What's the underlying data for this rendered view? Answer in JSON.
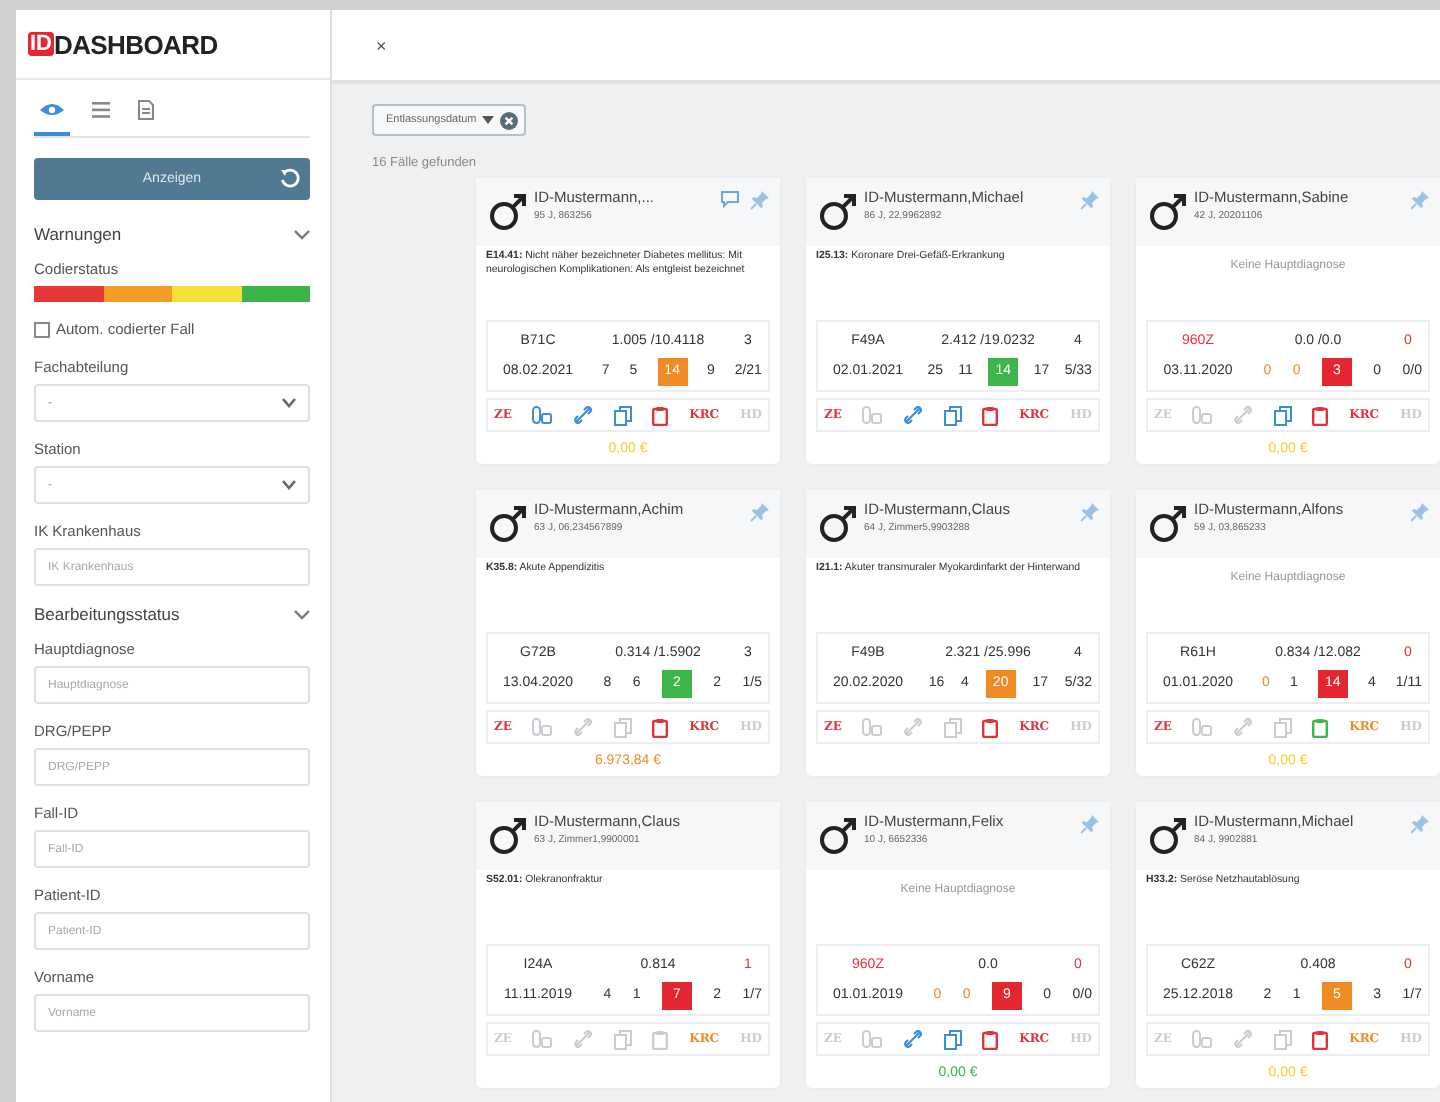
{
  "sidebar": {
    "brand": {
      "prefix": "ID",
      "name": "DASHBOARD"
    },
    "tabs": [
      {
        "kind": "eye",
        "selected": true
      },
      {
        "kind": "list",
        "selected": false
      },
      {
        "kind": "document",
        "selected": false
      }
    ],
    "button": "Anzeigen",
    "items": [
      {
        "kind": "section",
        "label": "Warnungen"
      },
      {
        "kind": "statusbar",
        "label": "Codierstatus",
        "segments": [
          {
            "color": "#e53935"
          },
          {
            "color": "#f39c26"
          },
          {
            "color": "#f7e03a"
          },
          {
            "color": "#3bb54a"
          }
        ]
      },
      {
        "kind": "checkbox",
        "label": "Autom. codierter Fall",
        "checked": false
      },
      {
        "kind": "select",
        "label": "Fachabteilung",
        "value": "-"
      },
      {
        "kind": "select",
        "label": "Station",
        "value": "-"
      },
      {
        "kind": "input",
        "label": "IK Krankenhaus",
        "placeholder": "IK Krankenhaus"
      },
      {
        "kind": "section",
        "label": "Bearbeitungsstatus"
      },
      {
        "kind": "input",
        "label": "Hauptdiagnose",
        "placeholder": "Hauptdiagnose"
      },
      {
        "kind": "input",
        "label": "DRG/PEPP",
        "placeholder": "DRG/PEPP"
      },
      {
        "kind": "input",
        "label": "Fall-ID",
        "placeholder": "Fall-ID"
      },
      {
        "kind": "input",
        "label": "Patient-ID",
        "placeholder": "Patient-ID"
      },
      {
        "kind": "input",
        "label": "Vorname",
        "placeholder": "Vorname"
      }
    ]
  },
  "toolbar": {
    "close": "×",
    "sort": "Entlassungsdatum",
    "result_count": "16 Fälle gefunden"
  },
  "cards": [
    {
      "name": "ID-Mustermann,...",
      "info": "95 J, 863256",
      "header_icons": [
        {
          "kind": "comment"
        },
        {
          "kind": "pin"
        }
      ],
      "diagnosis": "**E14.41:** Nicht näher bezeichneter Diabetes mellitus: Mit neurologischen Komplikationen: Als entgleist bezeichnet",
      "row1": [
        {
          "text": "B71C"
        },
        {
          "text": "1.005 /10.4118"
        },
        {
          "text": "3"
        }
      ],
      "row2": [
        {
          "text": "08.02.2021"
        },
        {
          "text": "7"
        },
        {
          "text": "5"
        },
        {
          "text": "14",
          "boxed": true,
          "color": "#f08a24"
        },
        {
          "text": "9"
        },
        {
          "text": "2/21"
        }
      ],
      "flags": [
        {
          "kind": "ze",
          "label": "ZE",
          "color": "#e0333a"
        },
        {
          "kind": "pills",
          "color": "#3b8ed8"
        },
        {
          "kind": "link",
          "color": "#3b8ed8"
        },
        {
          "kind": "copy",
          "color": "#3b8ed8"
        },
        {
          "kind": "clipboard",
          "color": "#e0333a"
        },
        {
          "kind": "krc",
          "label": "KRC",
          "color": "#e0333a"
        },
        {
          "kind": "hd",
          "label": "HD",
          "color": "#c9cdd1"
        }
      ],
      "amount": {
        "text": "0,00 €",
        "color": "#f2cf2c"
      }
    },
    {
      "name": "ID-Mustermann,Michael",
      "info": "86 J, 22,9962892",
      "header_icons": [
        {
          "kind": "pin"
        }
      ],
      "diagnosis": "**I25.13:** Koronare Drei-Gefäß-Erkrankung",
      "row1": [
        {
          "text": "F49A"
        },
        {
          "text": "2.412 /19.0232"
        },
        {
          "text": "4"
        }
      ],
      "row2": [
        {
          "text": "02.01.2021"
        },
        {
          "text": "25"
        },
        {
          "text": "11"
        },
        {
          "text": "14",
          "boxed": true,
          "color": "#3cb54a"
        },
        {
          "text": "17"
        },
        {
          "text": "5/33"
        }
      ],
      "flags": [
        {
          "kind": "ze",
          "label": "ZE",
          "color": "#e0333a"
        },
        {
          "kind": "pills",
          "color": "#c9cdd1"
        },
        {
          "kind": "link",
          "color": "#3b8ed8"
        },
        {
          "kind": "copy",
          "color": "#3b8ed8"
        },
        {
          "kind": "clipboard",
          "color": "#e0333a"
        },
        {
          "kind": "krc",
          "label": "KRC",
          "color": "#e0333a"
        },
        {
          "kind": "hd",
          "label": "HD",
          "color": "#c9cdd1"
        }
      ]
    },
    {
      "name": "ID-Mustermann,Sabine",
      "info": "42 J, 20201106",
      "header_icons": [
        {
          "kind": "pin"
        }
      ],
      "no_diagnosis": "Keine Hauptdiagnose",
      "row1": [
        {
          "text": "960Z",
          "color": "#e0333a"
        },
        {
          "text": "0.0 /0.0"
        },
        {
          "text": "0",
          "color": "#e0333a"
        }
      ],
      "row2": [
        {
          "text": "03.11.2020"
        },
        {
          "text": "0",
          "color": "#f08a24"
        },
        {
          "text": "0",
          "color": "#f08a24"
        },
        {
          "text": "3",
          "boxed": true,
          "color": "#e3262f"
        },
        {
          "text": "0"
        },
        {
          "text": "0/0"
        }
      ],
      "flags": [
        {
          "kind": "ze",
          "label": "ZE",
          "color": "#c9cdd1"
        },
        {
          "kind": "pills",
          "color": "#c9cdd1"
        },
        {
          "kind": "link",
          "color": "#c9cdd1"
        },
        {
          "kind": "copy",
          "color": "#3b8ed8"
        },
        {
          "kind": "clipboard",
          "color": "#e0333a"
        },
        {
          "kind": "krc",
          "label": "KRC",
          "color": "#e0333a"
        },
        {
          "kind": "hd",
          "label": "HD",
          "color": "#c9cdd1"
        }
      ],
      "amount": {
        "text": "0,00 €",
        "color": "#f2cf2c"
      }
    },
    {
      "name": "ID-Mustermann,Achim",
      "info": "63 J, 06,234567899",
      "header_icons": [
        {
          "kind": "pin"
        }
      ],
      "diagnosis": "**K35.8:** Akute Appendizitis",
      "row1": [
        {
          "text": "G72B"
        },
        {
          "text": "0.314 /1.5902"
        },
        {
          "text": "3"
        }
      ],
      "row2": [
        {
          "text": "13.04.2020"
        },
        {
          "text": "8"
        },
        {
          "text": "6"
        },
        {
          "text": "2",
          "boxed": true,
          "color": "#3cb54a"
        },
        {
          "text": "2"
        },
        {
          "text": "1/5"
        }
      ],
      "flags": [
        {
          "kind": "ze",
          "label": "ZE",
          "color": "#e0333a"
        },
        {
          "kind": "pills",
          "color": "#c9cdd1"
        },
        {
          "kind": "link",
          "color": "#c9cdd1"
        },
        {
          "kind": "copy",
          "color": "#c9cdd1"
        },
        {
          "kind": "clipboard",
          "color": "#e0333a"
        },
        {
          "kind": "krc",
          "label": "KRC",
          "color": "#e0333a"
        },
        {
          "kind": "hd",
          "label": "HD",
          "color": "#c9cdd1"
        }
      ],
      "amount": {
        "text": "6.973,84 €",
        "color": "#f08a24"
      }
    },
    {
      "name": "ID-Mustermann,Claus",
      "info": "64 J, Zimmer5,9903288",
      "header_icons": [
        {
          "kind": "pin"
        }
      ],
      "diagnosis": "**I21.1:** Akuter transmuraler Myokardinfarkt der Hinterwand",
      "row1": [
        {
          "text": "F49B"
        },
        {
          "text": "2.321 /25.996"
        },
        {
          "text": "4"
        }
      ],
      "row2": [
        {
          "text": "20.02.2020"
        },
        {
          "text": "16"
        },
        {
          "text": "4"
        },
        {
          "text": "20",
          "boxed": true,
          "color": "#f08a24"
        },
        {
          "text": "17"
        },
        {
          "text": "5/32"
        }
      ],
      "flags": [
        {
          "kind": "ze",
          "label": "ZE",
          "color": "#e0333a"
        },
        {
          "kind": "pills",
          "color": "#c9cdd1"
        },
        {
          "kind": "link",
          "color": "#c9cdd1"
        },
        {
          "kind": "copy",
          "color": "#c9cdd1"
        },
        {
          "kind": "clipboard",
          "color": "#e0333a"
        },
        {
          "kind": "krc",
          "label": "KRC",
          "color": "#e0333a"
        },
        {
          "kind": "hd",
          "label": "HD",
          "color": "#c9cdd1"
        }
      ]
    },
    {
      "name": "ID-Mustermann,Alfons",
      "info": "59 J, 03,865233",
      "header_icons": [
        {
          "kind": "pin"
        }
      ],
      "no_diagnosis": "Keine Hauptdiagnose",
      "row1": [
        {
          "text": "R61H"
        },
        {
          "text": "0.834 /12.082"
        },
        {
          "text": "0",
          "color": "#e0333a"
        }
      ],
      "row2": [
        {
          "text": "01.01.2020"
        },
        {
          "text": "0",
          "color": "#f08a24"
        },
        {
          "text": "1"
        },
        {
          "text": "14",
          "boxed": true,
          "color": "#e3262f"
        },
        {
          "text": "4"
        },
        {
          "text": "1/11"
        }
      ],
      "flags": [
        {
          "kind": "ze",
          "label": "ZE",
          "color": "#e0333a"
        },
        {
          "kind": "pills",
          "color": "#c9cdd1"
        },
        {
          "kind": "link",
          "color": "#c9cdd1"
        },
        {
          "kind": "copy",
          "color": "#c9cdd1"
        },
        {
          "kind": "clipboard",
          "color": "#3cb54a"
        },
        {
          "kind": "krc",
          "label": "KRC",
          "color": "#f08a24"
        },
        {
          "kind": "hd",
          "label": "HD",
          "color": "#c9cdd1"
        }
      ],
      "amount": {
        "text": "0,00 €",
        "color": "#f2cf2c"
      }
    },
    {
      "name": "ID-Mustermann,Claus",
      "info": "63 J, Zimmer1,9900001",
      "diagnosis": "**S52.01:** Olekranonfraktur",
      "row1": [
        {
          "text": "I24A"
        },
        {
          "text": "0.814"
        },
        {
          "text": "1",
          "color": "#e0333a"
        }
      ],
      "row2": [
        {
          "text": "11.11.2019"
        },
        {
          "text": "4"
        },
        {
          "text": "1"
        },
        {
          "text": "7",
          "boxed": true,
          "color": "#e3262f"
        },
        {
          "text": "2"
        },
        {
          "text": "1/7"
        }
      ],
      "flags": [
        {
          "kind": "ze",
          "label": "ZE",
          "color": "#c9cdd1"
        },
        {
          "kind": "pills",
          "color": "#c9cdd1"
        },
        {
          "kind": "link",
          "color": "#c9cdd1"
        },
        {
          "kind": "copy",
          "color": "#c9cdd1"
        },
        {
          "kind": "clipboard",
          "color": "#c9cdd1"
        },
        {
          "kind": "krc",
          "label": "KRC",
          "color": "#f08a24"
        },
        {
          "kind": "hd",
          "label": "HD",
          "color": "#c9cdd1"
        }
      ]
    },
    {
      "name": "ID-Mustermann,Felix",
      "info": "10 J, 6652336",
      "header_icons": [
        {
          "kind": "pin"
        }
      ],
      "no_diagnosis": "Keine Hauptdiagnose",
      "row1": [
        {
          "text": "960Z",
          "color": "#e0333a"
        },
        {
          "text": "0.0"
        },
        {
          "text": "0",
          "color": "#e0333a"
        }
      ],
      "row2": [
        {
          "text": "01.01.2019"
        },
        {
          "text": "0",
          "color": "#f08a24"
        },
        {
          "text": "0",
          "color": "#f08a24"
        },
        {
          "text": "9",
          "boxed": true,
          "color": "#e3262f"
        },
        {
          "text": "0"
        },
        {
          "text": "0/0"
        }
      ],
      "flags": [
        {
          "kind": "ze",
          "label": "ZE",
          "color": "#c9cdd1"
        },
        {
          "kind": "pills",
          "color": "#c9cdd1"
        },
        {
          "kind": "link",
          "color": "#3b8ed8"
        },
        {
          "kind": "copy",
          "color": "#3b8ed8"
        },
        {
          "kind": "clipboard",
          "color": "#e0333a"
        },
        {
          "kind": "krc",
          "label": "KRC",
          "color": "#e0333a"
        },
        {
          "kind": "hd",
          "label": "HD",
          "color": "#c9cdd1"
        }
      ],
      "amount": {
        "text": "0,00 €",
        "color": "#3cb54a"
      }
    },
    {
      "name": "ID-Mustermann,Michael",
      "info": "84 J, 9902881",
      "header_icons": [
        {
          "kind": "pin"
        }
      ],
      "diagnosis": "**H33.2:** Seröse Netzhautablösung",
      "row1": [
        {
          "text": "C62Z"
        },
        {
          "text": "0.408"
        },
        {
          "text": "0",
          "color": "#e0333a"
        }
      ],
      "row2": [
        {
          "text": "25.12.2018"
        },
        {
          "text": "2"
        },
        {
          "text": "1"
        },
        {
          "text": "5",
          "boxed": true,
          "color": "#f08a24"
        },
        {
          "text": "3"
        },
        {
          "text": "1/7"
        }
      ],
      "flags": [
        {
          "kind": "ze",
          "label": "ZE",
          "color": "#c9cdd1"
        },
        {
          "kind": "pills",
          "color": "#c9cdd1"
        },
        {
          "kind": "link",
          "color": "#c9cdd1"
        },
        {
          "kind": "copy",
          "color": "#c9cdd1"
        },
        {
          "kind": "clipboard",
          "color": "#e0333a"
        },
        {
          "kind": "krc",
          "label": "KRC",
          "color": "#f08a24"
        },
        {
          "kind": "hd",
          "label": "HD",
          "color": "#c9cdd1"
        }
      ],
      "amount": {
        "text": "0,00 €",
        "color": "#f2cf2c"
      }
    }
  ]
}
